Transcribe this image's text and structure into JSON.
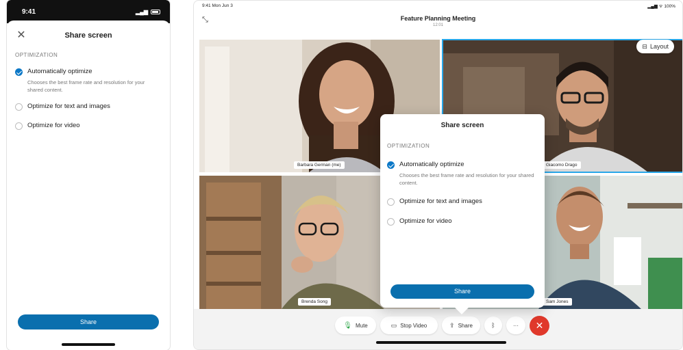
{
  "phone": {
    "time": "9:41",
    "status_signal": "▂▄▆",
    "sheet": {
      "close_glyph": "✕",
      "title": "Share screen",
      "section_label": "OPTIMIZATION",
      "options": [
        {
          "label": "Automatically optimize",
          "description": "Chooses the best frame rate and resolution for your shared content.",
          "selected": true
        },
        {
          "label": "Optimize for text and images",
          "selected": false
        },
        {
          "label": "Optimize for video",
          "selected": false
        }
      ],
      "share_label": "Share"
    }
  },
  "tablet": {
    "status": {
      "time": "9:41 Mon Jun 3",
      "right": "▂▄▆ ᯤ 100%"
    },
    "minimize_glyph": "⤡",
    "meeting_title": "Feature Planning Meeting",
    "meeting_time": "12:01",
    "layout_label": "Layout",
    "participants": [
      {
        "name": "Barbara German (me)"
      },
      {
        "name": "Giacomo Drago"
      },
      {
        "name": "Brenda Song"
      },
      {
        "name": "Sam Jones"
      }
    ],
    "popup": {
      "title": "Share screen",
      "section_label": "OPTIMIZATION",
      "options": [
        {
          "label": "Automatically optimize",
          "description": "Chooses the best frame rate and resolution for your shared content.",
          "selected": true
        },
        {
          "label": "Optimize for text and images",
          "selected": false
        },
        {
          "label": "Optimize for video",
          "selected": false
        }
      ],
      "share_label": "Share"
    },
    "controls": {
      "mute_label": "Mute",
      "stop_video_label": "Stop Video",
      "share_label": "Share",
      "more_glyph": "···",
      "end_glyph": "✕"
    }
  },
  "colors": {
    "accent": "#0a6fae",
    "active_speaker": "#28a7e8",
    "end_call": "#e0392b"
  }
}
